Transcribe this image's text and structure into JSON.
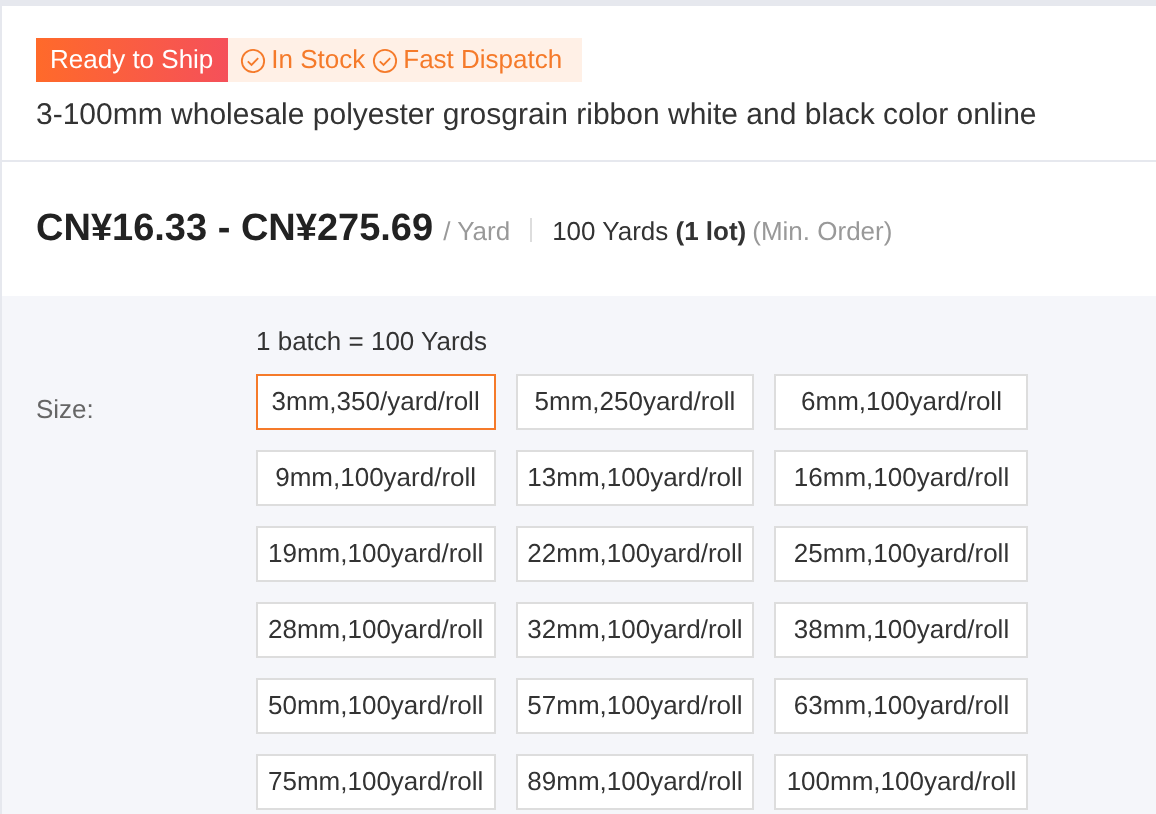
{
  "badges": {
    "primary": "Ready to Ship",
    "features": [
      "In Stock",
      "Fast Dispatch"
    ]
  },
  "title": "3-100mm wholesale polyester grosgrain ribbon white and black color online",
  "price": {
    "range": "CN¥16.33 - CN¥275.69",
    "unit": "/ Yard",
    "min_order_prefix": "100 Yards ",
    "min_order_lot": "(1 lot)",
    "min_order_suffix": "(Min. Order)"
  },
  "batch_note": "1 batch = 100 Yards",
  "size": {
    "label": "Size:",
    "options": [
      {
        "label": "3mm,350/yard/roll",
        "selected": true
      },
      {
        "label": "5mm,250yard/roll",
        "selected": false
      },
      {
        "label": "6mm,100yard/roll",
        "selected": false
      },
      {
        "label": "9mm,100yard/roll",
        "selected": false
      },
      {
        "label": "13mm,100yard/roll",
        "selected": false
      },
      {
        "label": "16mm,100yard/roll",
        "selected": false
      },
      {
        "label": "19mm,100yard/roll",
        "selected": false
      },
      {
        "label": "22mm,100yard/roll",
        "selected": false
      },
      {
        "label": "25mm,100yard/roll",
        "selected": false
      },
      {
        "label": "28mm,100yard/roll",
        "selected": false
      },
      {
        "label": "32mm,100yard/roll",
        "selected": false
      },
      {
        "label": "38mm,100yard/roll",
        "selected": false
      },
      {
        "label": "50mm,100yard/roll",
        "selected": false
      },
      {
        "label": "57mm,100yard/roll",
        "selected": false
      },
      {
        "label": "63mm,100yard/roll",
        "selected": false
      },
      {
        "label": "75mm,100yard/roll",
        "selected": false
      },
      {
        "label": "89mm,100yard/roll",
        "selected": false
      },
      {
        "label": "100mm,100yard/roll",
        "selected": false
      }
    ]
  }
}
